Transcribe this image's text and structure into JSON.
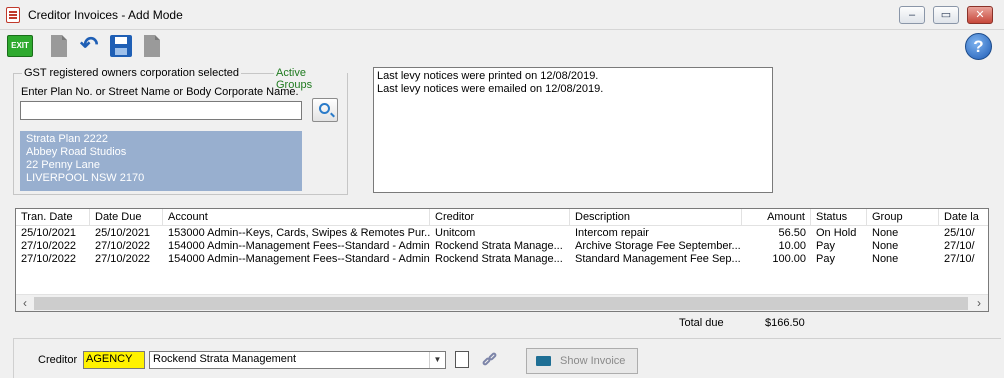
{
  "window": {
    "title": "Creditor Invoices - Add Mode",
    "minimize_glyph": "–",
    "restore_glyph": "▭",
    "close_glyph": "✕"
  },
  "toolbar": {
    "exit_label": "EXIT",
    "help_label": "?",
    "buttons": [
      "new-doc-icon",
      "undo-icon",
      "save-icon",
      "document-export-icon"
    ]
  },
  "selector": {
    "group_label": "GST registered owners corporation selected",
    "active_groups_label": "Active Groups",
    "plan_prompt": "Enter Plan No. or Street Name or Body Corporate Name.",
    "plan_input_value": "",
    "address_lines": [
      "Strata Plan 2222",
      "Abbey Road Studios",
      "22 Penny Lane",
      "LIVERPOOL  NSW  2170"
    ]
  },
  "notices": [
    "Last levy notices were printed on 12/08/2019.",
    "Last levy notices were emailed on 12/08/2019."
  ],
  "grid": {
    "columns": [
      "Tran. Date",
      "Date Due",
      "Account",
      "Creditor",
      "Description",
      "Amount",
      "Status",
      "Group",
      "Date la"
    ],
    "rows": [
      [
        "25/10/2021",
        "25/10/2021",
        "153000  Admin--Keys, Cards, Swipes & Remotes Pur...",
        "Unitcom",
        "Intercom repair",
        "56.50",
        "On Hold",
        "None",
        "25/10/"
      ],
      [
        "27/10/2022",
        "27/10/2022",
        "154000  Admin--Management Fees--Standard - Admin",
        "Rockend Strata Manage...",
        "Archive Storage Fee September...",
        "10.00",
        "Pay",
        "None",
        "27/10/"
      ],
      [
        "27/10/2022",
        "27/10/2022",
        "154000  Admin--Management Fees--Standard - Admin",
        "Rockend Strata Manage...",
        "Standard Management Fee Sep...",
        "100.00",
        "Pay",
        "None",
        "27/10/"
      ]
    ],
    "scroll_left": "‹",
    "scroll_right": "›"
  },
  "totals": {
    "label": "Total due",
    "value": "$166.50"
  },
  "creditor": {
    "label": "Creditor",
    "code_value": "AGENCY",
    "name_value": "Rockend Strata Management",
    "dropdown_glyph": "▼",
    "show_invoice_label": "Show Invoice"
  },
  "colors": {
    "address_bg": "#98afcf",
    "code_highlight": "#fff200",
    "active_groups": "#1f7a1f"
  }
}
